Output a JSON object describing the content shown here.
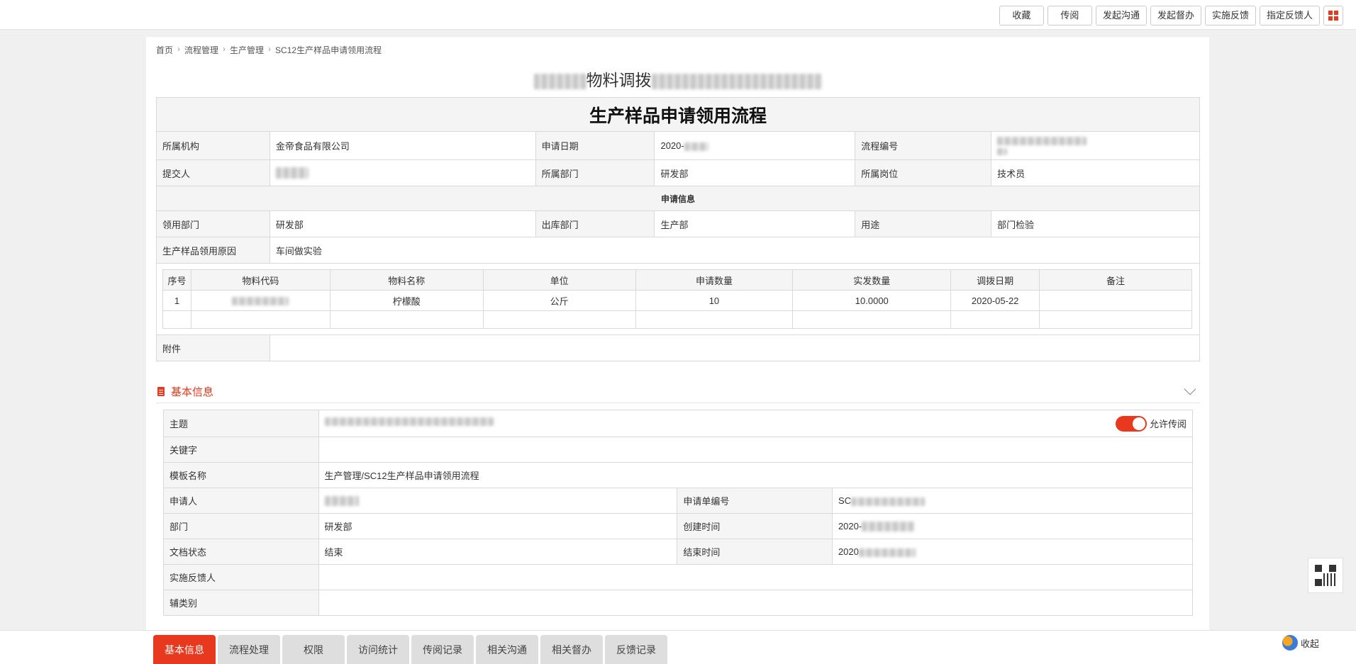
{
  "toolbar": {
    "buttons": [
      "收藏",
      "传阅",
      "发起沟通",
      "发起督办",
      "实施反馈",
      "指定反馈人"
    ],
    "apps_icon": "grid-icon",
    "accent": "#e8381e"
  },
  "breadcrumb": [
    "首页",
    "流程管理",
    "生产管理",
    "SC12生产样品申请领用流程"
  ],
  "doc_title": {
    "visible": "物料调拨"
  },
  "form": {
    "title": "生产样品申请领用流程",
    "org_label": "所属机构",
    "org_value": "金帝食品有限公司",
    "date_label": "申请日期",
    "date_value": "2020-",
    "flowno_label": "流程编号",
    "submitter_label": "提交人",
    "dept_label": "所属部门",
    "dept_value": "研发部",
    "post_label": "所属岗位",
    "post_value": "技术员",
    "section": "申请信息",
    "use_dept_label": "领用部门",
    "use_dept_value": "研发部",
    "out_dept_label": "出库部门",
    "out_dept_value": "生产部",
    "purpose_label": "用途",
    "purpose_value": "部门检验",
    "reason_label": "生产样品领用原因",
    "reason_value": "车间做实验",
    "attach_label": "附件"
  },
  "items": {
    "headers": [
      "序号",
      "物料代码",
      "物料名称",
      "单位",
      "申请数量",
      "实发数量",
      "调拨日期",
      "备注"
    ],
    "rows": [
      {
        "no": "1",
        "code": "",
        "name": "柠檬酸",
        "unit": "公斤",
        "qty": "10",
        "actual": "10.0000",
        "date": "2020-05-22",
        "note": ""
      }
    ]
  },
  "basic": {
    "heading": "基本信息",
    "subject_label": "主题",
    "allow_label": "允许传阅",
    "keyword_label": "关键字",
    "template_label": "模板名称",
    "template_value": "生产管理/SC12生产样品申请领用流程",
    "applicant_label": "申请人",
    "appno_label": "申请单编号",
    "appno_value": "SC",
    "dept_label": "部门",
    "dept_value": "研发部",
    "created_label": "创建时间",
    "created_value": "2020-",
    "status_label": "文档状态",
    "status_value": "结束",
    "end_label": "结束时间",
    "end_value": "2020",
    "feedback_label": "实施反馈人",
    "subcat_label": "辅类别"
  },
  "tabs": [
    "基本信息",
    "流程处理",
    "权限",
    "访问统计",
    "传阅记录",
    "相关沟通",
    "相关督办",
    "反馈记录"
  ],
  "side": {
    "collapse_label": "收起",
    "qr_icon": "qr-code-icon"
  }
}
